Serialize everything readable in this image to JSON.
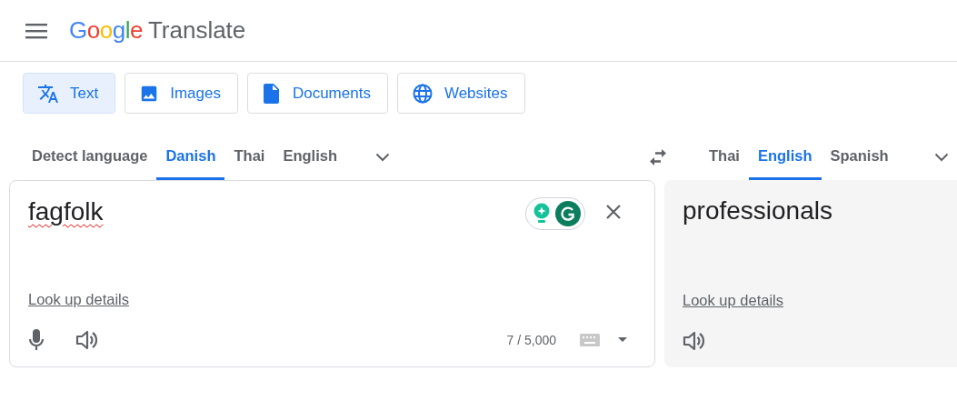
{
  "header": {
    "logo_brand": "Google",
    "logo_product": "Translate"
  },
  "modes": [
    {
      "label": "Text",
      "kind": "text",
      "selected": true
    },
    {
      "label": "Images",
      "kind": "image",
      "selected": false
    },
    {
      "label": "Documents",
      "kind": "document",
      "selected": false
    },
    {
      "label": "Websites",
      "kind": "globe",
      "selected": false
    }
  ],
  "source_languages": [
    {
      "label": "Detect language",
      "selected": false
    },
    {
      "label": "Danish",
      "selected": true
    },
    {
      "label": "Thai",
      "selected": false
    },
    {
      "label": "English",
      "selected": false
    }
  ],
  "target_languages": [
    {
      "label": "Thai",
      "selected": false
    },
    {
      "label": "English",
      "selected": true
    },
    {
      "label": "Spanish",
      "selected": false
    }
  ],
  "source": {
    "text": "fagfolk",
    "misspelled": true,
    "lookup": "Look up details",
    "count": "7 / 5,000"
  },
  "target": {
    "text": "professionals",
    "lookup": "Look up details"
  }
}
